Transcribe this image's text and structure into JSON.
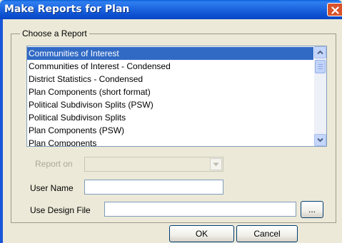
{
  "window": {
    "title": "Make Reports for Plan"
  },
  "group": {
    "legend": "Choose a Report"
  },
  "report_list": {
    "items": [
      "Communities of Interest",
      "Communities of Interest - Condensed",
      "District Statistics - Condensed",
      "Plan Components (short format)",
      "Political Subdivison Splits (PSW)",
      "Political Subdivison Splits",
      "Plan Components (PSW)",
      "Plan Components"
    ],
    "selected_index": 0
  },
  "fields": {
    "report_on_label": "Report on",
    "report_on_value": "",
    "user_name_label": "User Name",
    "user_name_value": "",
    "design_file_label": "Use Design File",
    "design_file_value": "",
    "browse_label": "..."
  },
  "buttons": {
    "ok": "OK",
    "cancel": "Cancel"
  },
  "colors": {
    "titlebar": "#0a5fd6",
    "selection": "#316ac5",
    "background": "#ece9d8"
  },
  "icons": {
    "close": "close-icon",
    "scroll_up": "chevron-up-icon",
    "scroll_down": "chevron-down-icon",
    "dropdown": "chevron-down-icon"
  }
}
